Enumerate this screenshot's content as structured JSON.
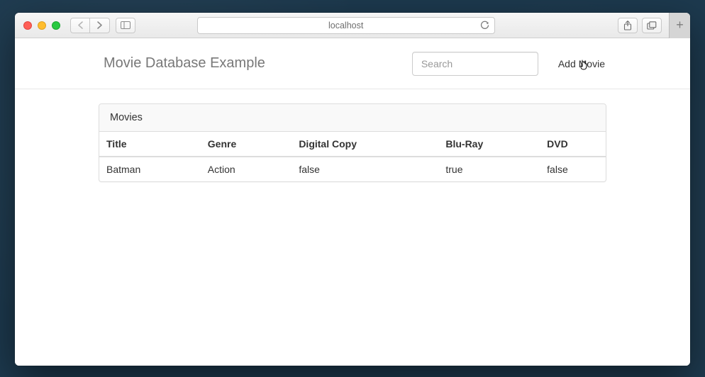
{
  "browser": {
    "address": "localhost"
  },
  "app": {
    "brand": "Movie Database Example",
    "search_placeholder": "Search",
    "add_movie_label": "Add Movie"
  },
  "panel": {
    "heading": "Movies",
    "columns": {
      "title": "Title",
      "genre": "Genre",
      "digital_copy": "Digital Copy",
      "blu_ray": "Blu-Ray",
      "dvd": "DVD"
    },
    "rows": [
      {
        "title": "Batman",
        "genre": "Action",
        "digital_copy": "false",
        "blu_ray": "true",
        "dvd": "false"
      }
    ]
  }
}
